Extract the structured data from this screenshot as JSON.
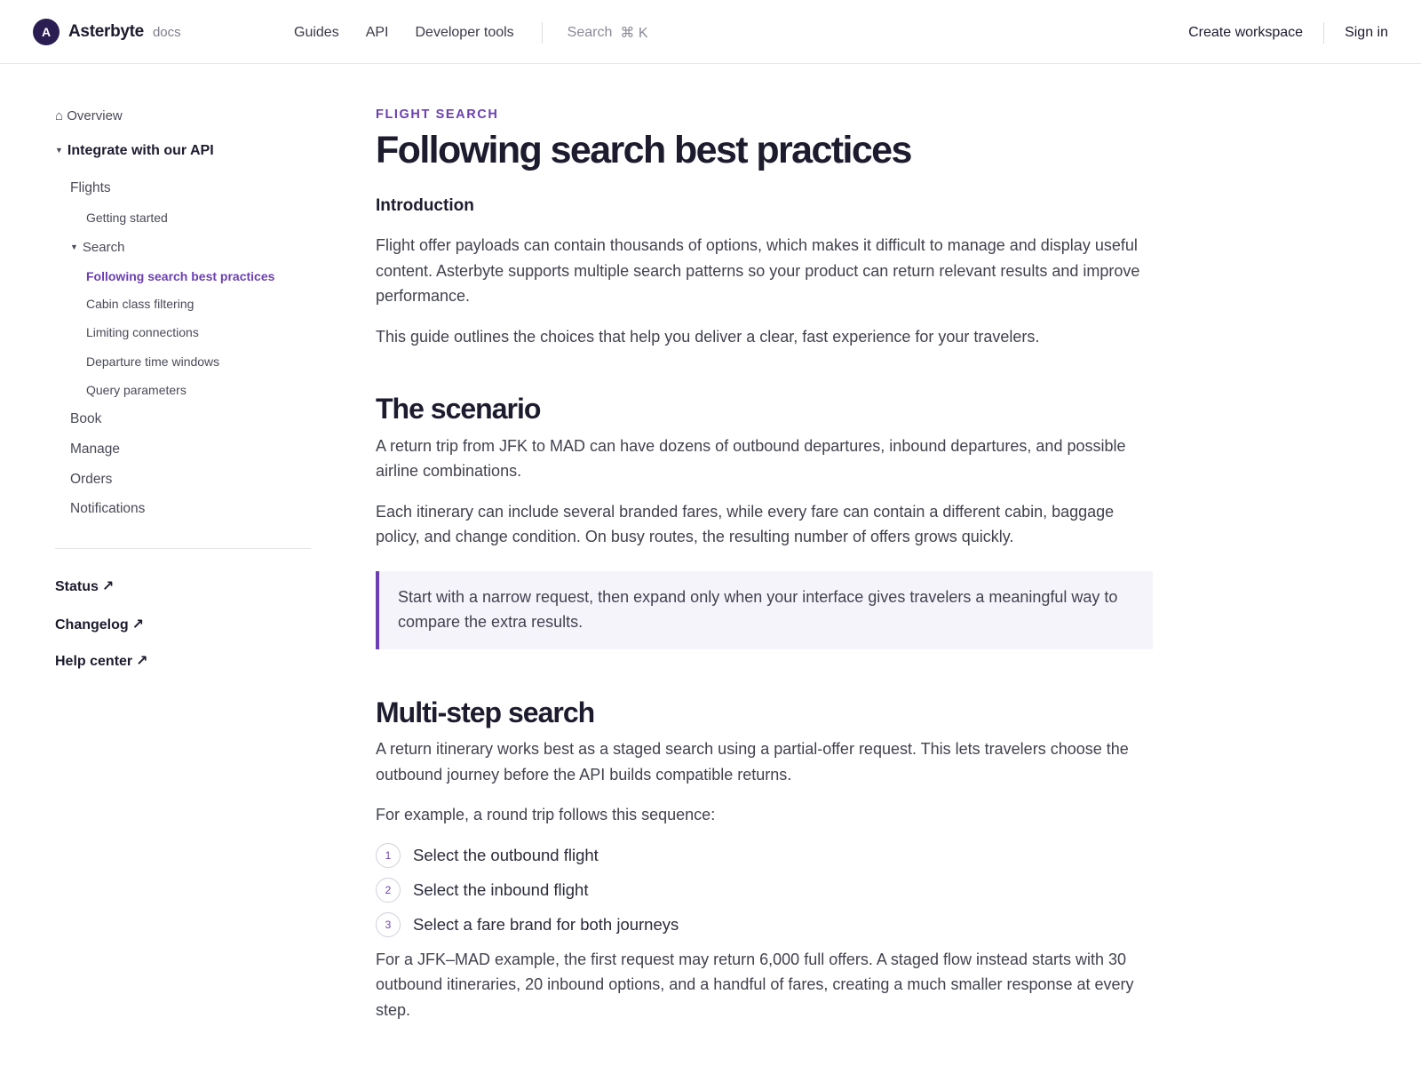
{
  "header": {
    "logo_letter": "A",
    "brand": "Asterbyte",
    "product": "docs",
    "nav": [
      "Guides",
      "API",
      "Developer tools"
    ],
    "search_label": "Search",
    "search_shortcut": "⌘ K",
    "create_workspace": "Create workspace",
    "sign_in": "Sign in"
  },
  "sidebar": {
    "overview": "Overview",
    "group": "Integrate with our API",
    "flights": "Flights",
    "getting_started": "Getting started",
    "search": "Search",
    "search_children": [
      "Following search best practices",
      "Cabin class filtering",
      "Limiting connections",
      "Departure time windows",
      "Query parameters"
    ],
    "other_sections": [
      "Book",
      "Manage",
      "Orders",
      "Notifications"
    ],
    "external_links": [
      "Status",
      "Changelog",
      "Help center"
    ]
  },
  "article": {
    "eyebrow": "FLIGHT SEARCH",
    "title": "Following search best practices",
    "intro_heading": "Introduction",
    "intro_p1": "Flight offer payloads can contain thousands of options, which makes it difficult to manage and display useful content. Asterbyte supports multiple search patterns so your product can return relevant results and improve performance.",
    "intro_p2": "This guide outlines the choices that help you deliver a clear, fast experience for your travelers.",
    "scenario_heading": "The scenario",
    "scenario_p1": "A return trip from JFK to MAD can have dozens of outbound departures, inbound departures, and possible airline combinations.",
    "scenario_p2": "Each itinerary can include several branded fares, while every fare can contain a different cabin, baggage policy, and change condition. On busy routes, the resulting number of offers grows quickly.",
    "callout": "Start with a narrow request, then expand only when your interface gives travelers a meaningful way to compare the extra results.",
    "multistep_heading": "Multi-step search",
    "multistep_p1": "A return itinerary works best as a staged search using a partial-offer request. This lets travelers choose the outbound journey before the API builds compatible returns.",
    "multistep_p2": "For example, a round trip follows this sequence:",
    "steps": [
      {
        "num": "1",
        "text": "Select the outbound flight"
      },
      {
        "num": "2",
        "text": "Select the inbound flight"
      },
      {
        "num": "3",
        "text": "Select a fare brand for both journeys"
      }
    ],
    "multistep_p3": "For a JFK–MAD example, the first request may return 6,000 full offers. A staged flow instead starts with 30 outbound itineraries, 20 inbound options, and a handful of fares, creating a much smaller response at every step."
  },
  "colors": {
    "accent": "#6b3fb3",
    "logo_bg": "#2a1d52",
    "heading": "#1d1b2e",
    "callout_bg": "#f6f4fb"
  }
}
